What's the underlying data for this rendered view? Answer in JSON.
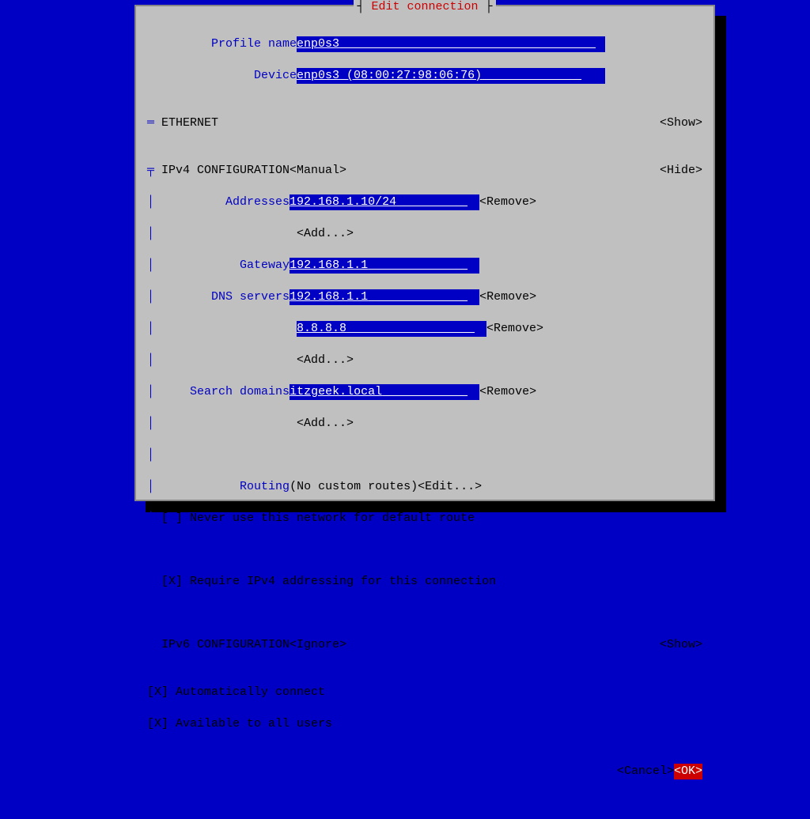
{
  "title": "Edit connection",
  "profile": {
    "name_label": "Profile name",
    "device_label": "Device",
    "name_value": "enp0s3",
    "device_value": "enp0s3 (08:00:27:98:06:76)"
  },
  "ethernet": {
    "heading": "ETHERNET",
    "show": "<Show>"
  },
  "ipv4": {
    "heading": "IPv4 CONFIGURATION",
    "mode": "<Manual>",
    "hide": "<Hide>",
    "addresses_label": "Addresses",
    "address_value": "192.168.1.10/24",
    "add": "<Add...>",
    "remove": "<Remove>",
    "gateway_label": "Gateway",
    "gateway_value": "192.168.1.1",
    "dns_label": "DNS servers",
    "dns1": "192.168.1.1",
    "dns2": "8.8.8.8",
    "search_label": "Search domains",
    "search_value": "itzgeek.local",
    "routing_label": "Routing",
    "routing_status": "(No custom routes)",
    "routing_edit": "<Edit...>",
    "never_default": "[ ] Never use this network for default route",
    "require_ipv4": "[X] Require IPv4 addressing for this connection"
  },
  "ipv6": {
    "heading": "IPv6 CONFIGURATION",
    "mode": "<Ignore>",
    "show": "<Show>"
  },
  "footer": {
    "auto_connect": "[X] Automatically connect",
    "all_users": "[X] Available to all users",
    "cancel": "<Cancel>",
    "ok": "<OK>"
  }
}
